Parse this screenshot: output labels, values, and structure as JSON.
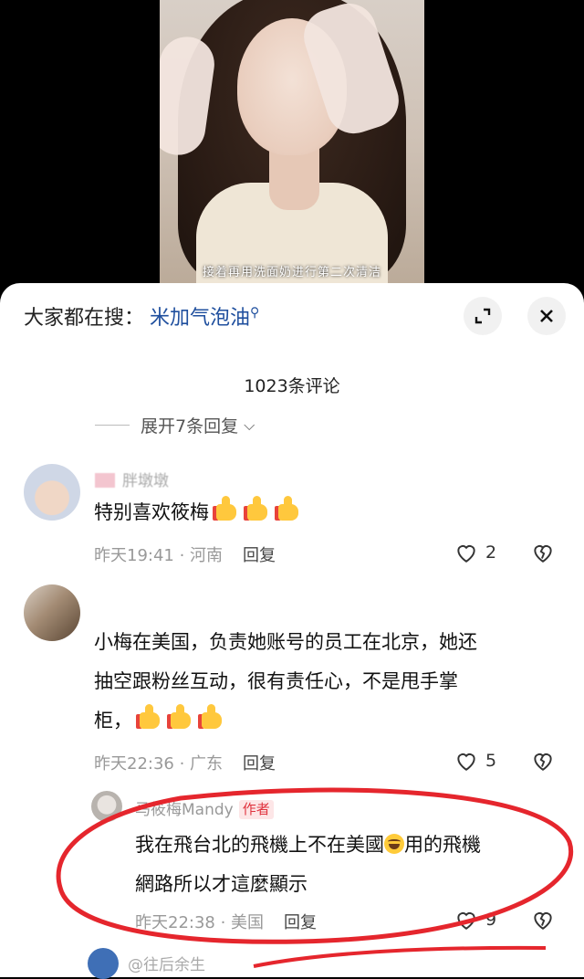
{
  "video": {
    "caption": "接着再用洗面奶进行第二次清洁"
  },
  "search": {
    "prefix": "大家都在搜：",
    "keyword": "米加气泡油"
  },
  "comments_header": {
    "count_text": "1023条评论",
    "expand_replies": "展开7条回复"
  },
  "comments": [
    {
      "username": "胖墩墩",
      "text": "特别喜欢筱梅",
      "time": "昨天19:41",
      "location": "河南",
      "reply_label": "回复",
      "likes": "2"
    },
    {
      "text_lines": [
        "小梅在美国，负责她账号的员工在北京，她还",
        "抽空跟粉丝互动，很有责任心，不是甩手掌",
        "柜，"
      ],
      "time": "昨天22:36",
      "location": "广东",
      "reply_label": "回复",
      "likes": "5"
    }
  ],
  "author_reply": {
    "username": "马筱梅Mandy",
    "tag": "作者",
    "line1a": "我在飛台北的飛機上不在美國",
    "line1b": "用的飛機",
    "line2": "網路所以才這麼顯示",
    "time": "昨天22:38",
    "location": "美国",
    "reply_label": "回复",
    "likes": "9"
  },
  "next_comment": {
    "username": "@往后余生"
  },
  "colors": {
    "accent_blue": "#1f4f9e",
    "author_red": "#e0343f",
    "annotation_red": "#e5262d"
  }
}
